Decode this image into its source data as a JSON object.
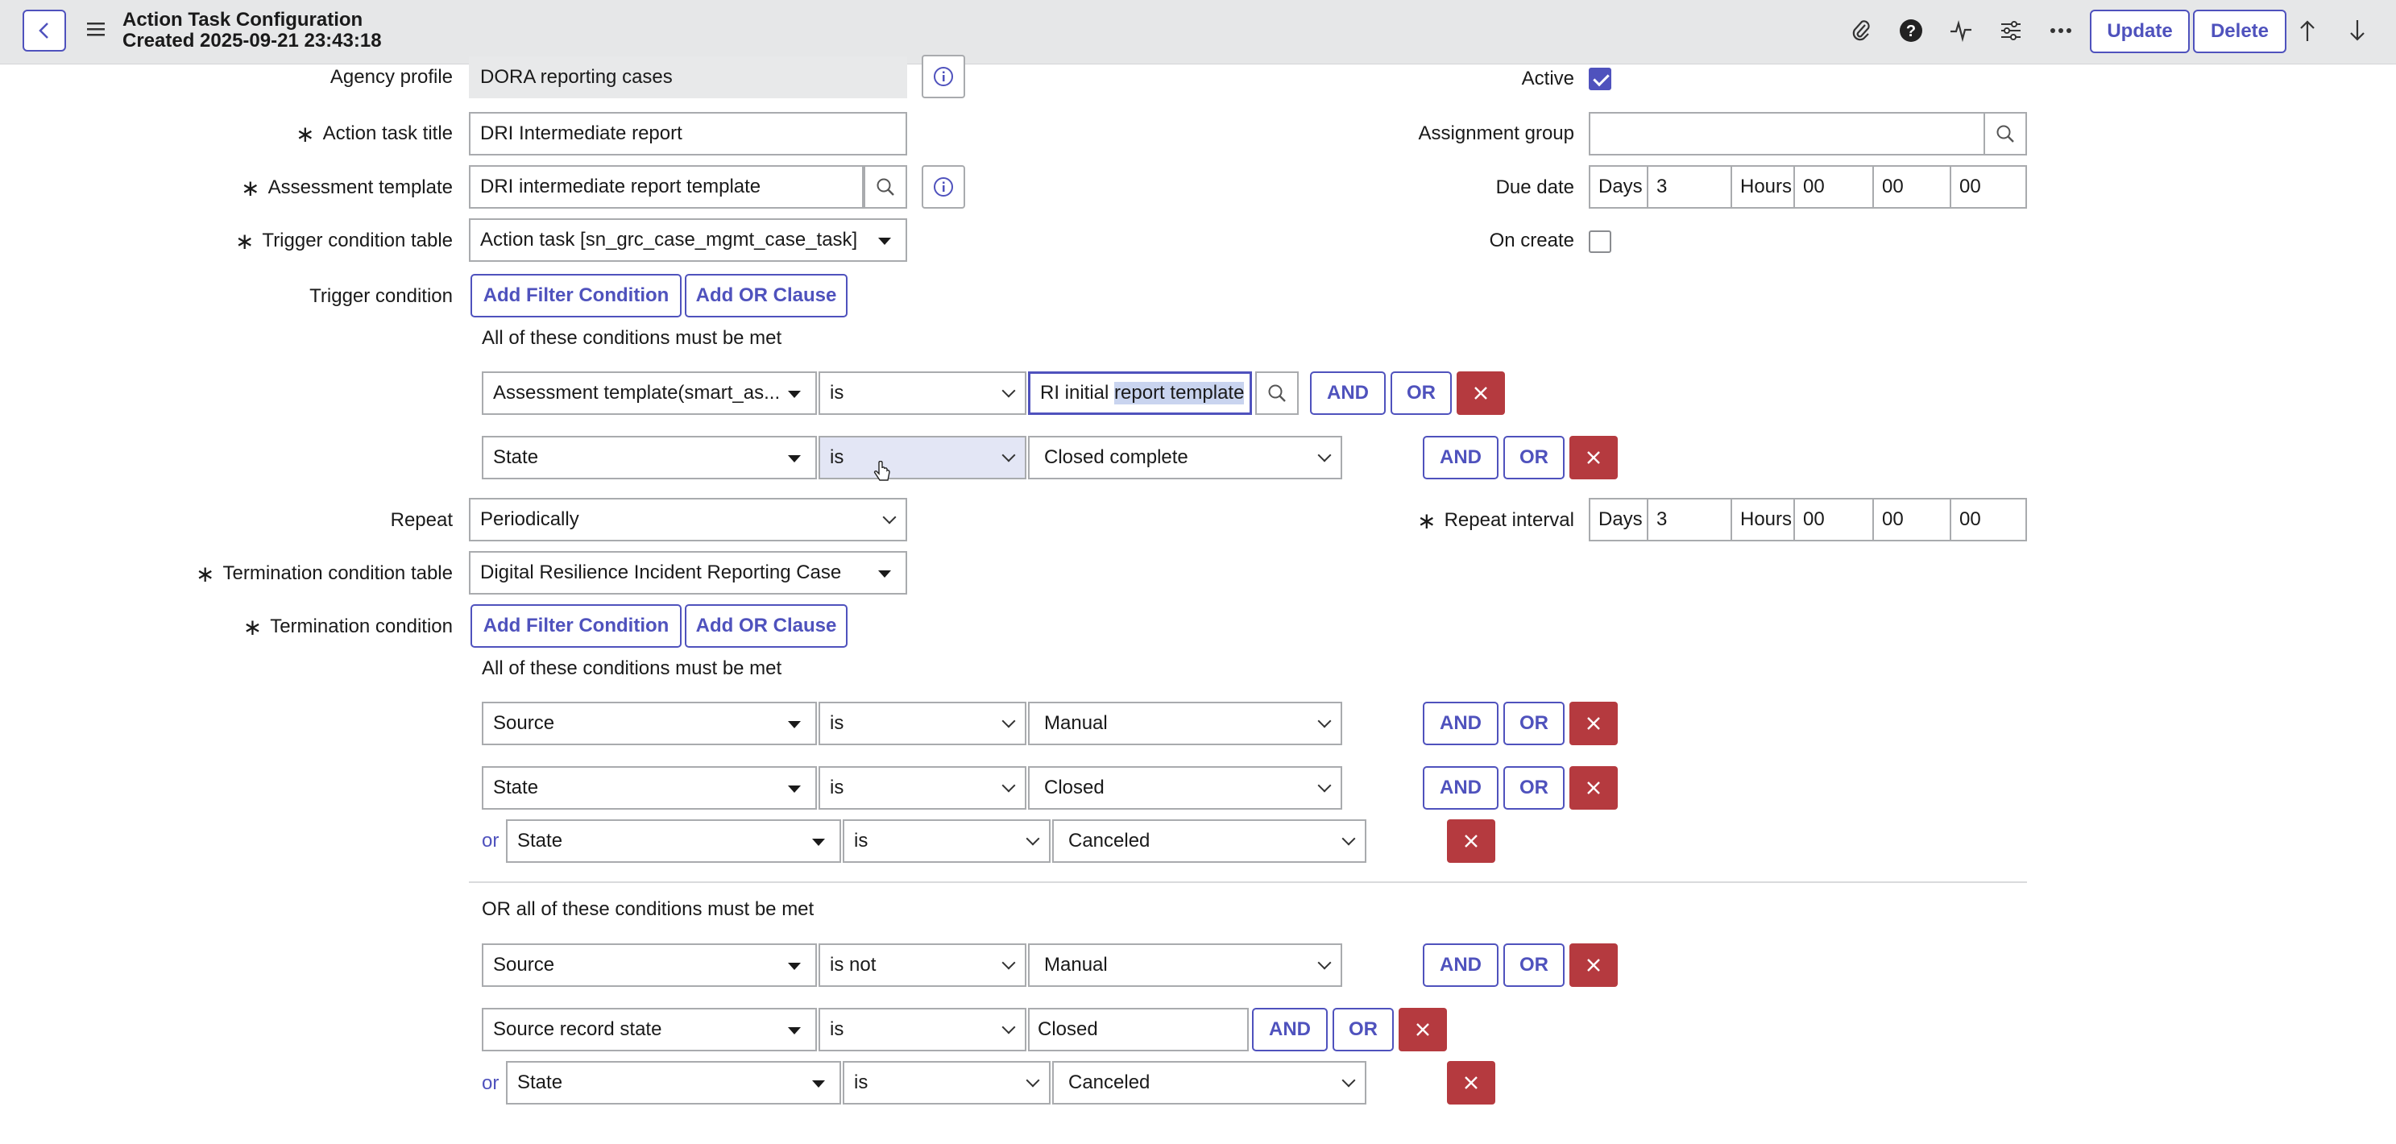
{
  "header": {
    "title": "Action Task Configuration",
    "subtitle": "Created 2025-09-21 23:43:18",
    "update_label": "Update",
    "delete_label": "Delete"
  },
  "form": {
    "agency_profile": {
      "label": "Agency profile",
      "value": "DORA reporting cases"
    },
    "action_task_title": {
      "label": "Action task title",
      "value": "DRI Intermediate report"
    },
    "assessment_template": {
      "label": "Assessment template",
      "value": "DRI intermediate report template"
    },
    "trigger_condition_table": {
      "label": "Trigger condition table",
      "value": "Action task [sn_grc_case_mgmt_case_task]"
    },
    "trigger_condition": {
      "label": "Trigger condition"
    },
    "repeat": {
      "label": "Repeat",
      "value": "Periodically"
    },
    "termination_condition_table": {
      "label": "Termination condition table",
      "value": "Digital Resilience Incident Reporting Case"
    },
    "termination_condition": {
      "label": "Termination condition"
    },
    "active": {
      "label": "Active",
      "checked": true
    },
    "assignment_group": {
      "label": "Assignment group",
      "value": ""
    },
    "due_date": {
      "label": "Due date",
      "days_label": "Days",
      "days": "3",
      "hours_label": "Hours",
      "hours": "00",
      "minutes": "00",
      "seconds": "00"
    },
    "on_create": {
      "label": "On create",
      "checked": false
    },
    "repeat_interval": {
      "label": "Repeat interval",
      "days_label": "Days",
      "days": "3",
      "hours_label": "Hours",
      "hours": "00",
      "minutes": "00",
      "seconds": "00"
    }
  },
  "buttons": {
    "add_filter_condition": "Add Filter Condition",
    "add_or_clause": "Add OR Clause",
    "and": "AND",
    "or": "OR",
    "or_prefix": "or"
  },
  "trigger": {
    "heading": "All of these conditions must be met",
    "rows": [
      {
        "field": "Assessment template(smart_as...",
        "operator": "is",
        "value_a": "RI initial ",
        "value_b": "report template"
      },
      {
        "field": "State",
        "operator": "is",
        "value": "Closed complete"
      }
    ]
  },
  "termination": {
    "heading1": "All of these conditions must be met",
    "group1": [
      {
        "field": "Source",
        "operator": "is",
        "value": "Manual"
      },
      {
        "field": "State",
        "operator": "is",
        "value": "Closed"
      },
      {
        "field": "State",
        "operator": "is",
        "value": "Canceled"
      }
    ],
    "heading2": "OR all of these conditions must be met",
    "group2": [
      {
        "field": "Source",
        "operator": "is not",
        "value": "Manual"
      },
      {
        "field": "Source record state",
        "operator": "is",
        "value": "Closed"
      },
      {
        "field": "State",
        "operator": "is",
        "value": "Canceled"
      }
    ]
  },
  "colors": {
    "accent": "#4f52bd",
    "danger": "#b53a3f",
    "header_bg": "#e6e7e8"
  }
}
